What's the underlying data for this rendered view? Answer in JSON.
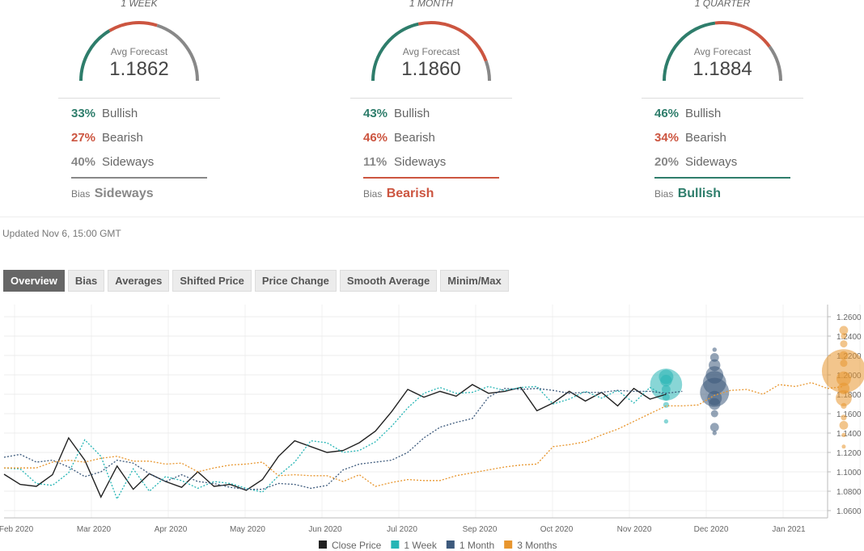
{
  "forecasts": [
    {
      "period": "1 WEEK",
      "avg_label": "Avg Forecast",
      "avg": "1.1862",
      "bullish_pct": "33%",
      "bullish_label": "Bullish",
      "bearish_pct": "27%",
      "bearish_label": "Bearish",
      "sideways_pct": "40%",
      "sideways_label": "Sideways",
      "bias_label": "Bias",
      "bias": "Sideways",
      "bias_color": "#888888"
    },
    {
      "period": "1 MONTH",
      "avg_label": "Avg Forecast",
      "avg": "1.1860",
      "bullish_pct": "43%",
      "bullish_label": "Bullish",
      "bearish_pct": "46%",
      "bearish_label": "Bearish",
      "sideways_pct": "11%",
      "sideways_label": "Sideways",
      "bias_label": "Bias",
      "bias": "Bearish",
      "bias_color": "#cc5540"
    },
    {
      "period": "1 QUARTER",
      "avg_label": "Avg Forecast",
      "avg": "1.1884",
      "bullish_pct": "46%",
      "bullish_label": "Bullish",
      "bearish_pct": "34%",
      "bearish_label": "Bearish",
      "sideways_pct": "20%",
      "sideways_label": "Sideways",
      "bias_label": "Bias",
      "bias": "Bullish",
      "bias_color": "#2e7d6b"
    }
  ],
  "colors": {
    "bullish": "#2e7d6b",
    "bearish": "#cc5540",
    "sideways": "#888888"
  },
  "updated": "Updated Nov 6, 15:00 GMT",
  "tabs": [
    "Overview",
    "Bias",
    "Averages",
    "Shifted Price",
    "Price Change",
    "Smooth Average",
    "Minim/Max"
  ],
  "chart_data": {
    "type": "line",
    "x_ticks": [
      "Feb 2020",
      "Mar 2020",
      "Apr 2020",
      "May 2020",
      "Jun 2020",
      "Jul 2020",
      "Sep 2020",
      "Oct 2020",
      "Nov 2020",
      "Dec 2020",
      "Jan 2021"
    ],
    "y_ticks": [
      "1.2600",
      "1.2400",
      "1.2200",
      "1.2000",
      "1.1800",
      "1.1600",
      "1.1400",
      "1.1200",
      "1.1000",
      "1.0800",
      "1.0600"
    ],
    "ylim": [
      1.0525,
      1.2725
    ],
    "xlim": [
      0,
      51
    ],
    "grid": true,
    "legend_position": "bottom",
    "series": [
      {
        "name": "Close Price",
        "color": "#222222",
        "dashed": false,
        "values": [
          1.0975,
          1.087,
          1.085,
          1.097,
          1.135,
          1.112,
          1.074,
          1.106,
          1.082,
          1.098,
          1.09,
          1.084,
          1.1,
          1.085,
          1.087,
          1.081,
          1.092,
          1.116,
          1.132,
          1.126,
          1.12,
          1.122,
          1.13,
          1.142,
          1.162,
          1.185,
          1.177,
          1.183,
          1.178,
          1.19,
          1.181,
          1.183,
          1.187,
          1.163,
          1.171,
          1.183,
          1.173,
          1.182,
          1.168,
          1.186,
          1.175,
          1.18
        ]
      },
      {
        "name": "1 Week",
        "color": "#26b5b5",
        "dashed": true,
        "values": [
          1.104,
          1.103,
          1.088,
          1.086,
          1.099,
          1.133,
          1.116,
          1.072,
          1.103,
          1.08,
          1.095,
          1.091,
          1.083,
          1.09,
          1.088,
          1.083,
          1.079,
          1.096,
          1.11,
          1.132,
          1.13,
          1.12,
          1.122,
          1.131,
          1.147,
          1.166,
          1.181,
          1.187,
          1.181,
          1.182,
          1.188,
          1.184,
          1.187,
          1.188,
          1.17,
          1.175,
          1.183,
          1.176,
          1.184,
          1.171,
          1.187,
          1.178
        ]
      },
      {
        "name": "1 Month",
        "color": "#3d5a7c",
        "dashed": true,
        "values": [
          1.115,
          1.118,
          1.11,
          1.112,
          1.105,
          1.095,
          1.1,
          1.112,
          1.109,
          1.098,
          1.09,
          1.097,
          1.09,
          1.088,
          1.084,
          1.082,
          1.082,
          1.088,
          1.087,
          1.083,
          1.086,
          1.102,
          1.108,
          1.11,
          1.112,
          1.12,
          1.135,
          1.146,
          1.151,
          1.155,
          1.177,
          1.186,
          1.185,
          1.186,
          1.184,
          1.181,
          1.182,
          1.182,
          1.184,
          1.183,
          1.183,
          1.181,
          1.183
        ]
      },
      {
        "name": "3 Months",
        "color": "#e8962e",
        "dashed": true,
        "values": [
          1.104,
          1.104,
          1.104,
          1.11,
          1.112,
          1.11,
          1.114,
          1.116,
          1.111,
          1.111,
          1.108,
          1.109,
          1.1,
          1.104,
          1.107,
          1.108,
          1.11,
          1.096,
          1.097,
          1.096,
          1.096,
          1.09,
          1.097,
          1.085,
          1.089,
          1.092,
          1.091,
          1.091,
          1.096,
          1.099,
          1.102,
          1.105,
          1.107,
          1.108,
          1.126,
          1.128,
          1.131,
          1.138,
          1.144,
          1.152,
          1.16,
          1.168,
          1.168,
          1.169,
          1.179,
          1.184,
          1.185,
          1.18,
          1.19,
          1.188,
          1.192,
          1.186,
          1.188
        ]
      }
    ],
    "forecast_bubbles": [
      {
        "series": "1 Week",
        "x": 41,
        "points": [
          [
            1.19,
            2.2
          ],
          [
            1.198,
            1
          ],
          [
            1.194,
            0.8
          ],
          [
            1.185,
            0.6
          ],
          [
            1.177,
            0.5
          ],
          [
            1.169,
            0.4
          ],
          [
            1.152,
            0.3
          ]
        ]
      },
      {
        "series": "1 Month",
        "x": 44,
        "points": [
          [
            1.226,
            0.3
          ],
          [
            1.218,
            0.6
          ],
          [
            1.21,
            0.8
          ],
          [
            1.2,
            1.2
          ],
          [
            1.192,
            1.6
          ],
          [
            1.182,
            2
          ],
          [
            1.176,
            1
          ],
          [
            1.17,
            0.8
          ],
          [
            1.16,
            0.5
          ],
          [
            1.146,
            0.6
          ],
          [
            1.14,
            0.3
          ]
        ]
      },
      {
        "series": "3 Months",
        "x": 52,
        "points": [
          [
            1.246,
            0.6
          ],
          [
            1.24,
            0.4
          ],
          [
            1.232,
            0.5
          ],
          [
            1.22,
            0.6
          ],
          [
            1.212,
            0.5
          ],
          [
            1.204,
            3
          ],
          [
            1.196,
            1
          ],
          [
            1.186,
            0.8
          ],
          [
            1.176,
            1.1
          ],
          [
            1.168,
            0.4
          ],
          [
            1.156,
            0.4
          ],
          [
            1.148,
            0.6
          ],
          [
            1.138,
            0.3
          ],
          [
            1.126,
            0.2
          ]
        ]
      }
    ]
  }
}
